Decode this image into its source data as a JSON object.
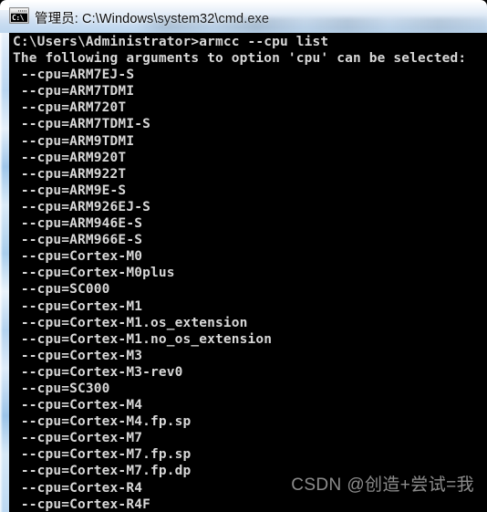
{
  "window": {
    "title": "管理员: C:\\Windows\\system32\\cmd.exe",
    "icon_name": "cmd-console-icon",
    "icon_glyph": "C:\\",
    "titlebar_color": "#cfe0f2",
    "console_background": "#000000",
    "console_foreground": "#d8d8d8"
  },
  "console": {
    "prompt_line": "C:\\Users\\Administrator>armcc --cpu list",
    "message_line": "The following arguments to option 'cpu' can be selected:",
    "cpu_options": [
      " --cpu=ARM7EJ-S",
      " --cpu=ARM7TDMI",
      " --cpu=ARM720T",
      " --cpu=ARM7TDMI-S",
      " --cpu=ARM9TDMI",
      " --cpu=ARM920T",
      " --cpu=ARM922T",
      " --cpu=ARM9E-S",
      " --cpu=ARM926EJ-S",
      " --cpu=ARM946E-S",
      " --cpu=ARM966E-S",
      " --cpu=Cortex-M0",
      " --cpu=Cortex-M0plus",
      " --cpu=SC000",
      " --cpu=Cortex-M1",
      " --cpu=Cortex-M1.os_extension",
      " --cpu=Cortex-M1.no_os_extension",
      " --cpu=Cortex-M3",
      " --cpu=Cortex-M3-rev0",
      " --cpu=SC300",
      " --cpu=Cortex-M4",
      " --cpu=Cortex-M4.fp.sp",
      " --cpu=Cortex-M7",
      " --cpu=Cortex-M7.fp.sp",
      " --cpu=Cortex-M7.fp.dp",
      " --cpu=Cortex-R4",
      " --cpu=Cortex-R4F"
    ]
  },
  "watermark": {
    "text": "CSDN @创造+尝试=我"
  }
}
